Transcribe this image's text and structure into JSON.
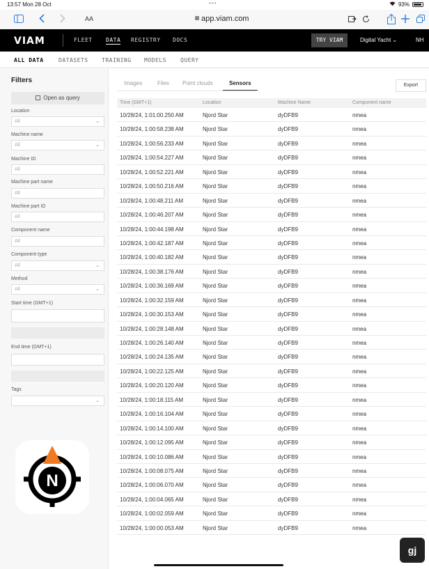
{
  "status_bar": {
    "time": "13:57  Mon 28 Oct",
    "dots": "•••",
    "battery": "93%"
  },
  "browser": {
    "aa": "AA",
    "url": "app.viam.com"
  },
  "topnav": {
    "logo": "VIAM",
    "links": [
      "FLEET",
      "DATA",
      "REGISTRY",
      "DOCS"
    ],
    "try_label": "TRY VIAM",
    "org": "Digital Yacht",
    "user": "NH"
  },
  "subnav": [
    "ALL DATA",
    "DATASETS",
    "TRAINING",
    "MODELS",
    "QUERY"
  ],
  "filters": {
    "title": "Filters",
    "open_query": "Open as query",
    "location": {
      "label": "Location",
      "value": "All"
    },
    "machine_name": {
      "label": "Machine name",
      "value": "All"
    },
    "machine_id": {
      "label": "Machine ID",
      "value": "All"
    },
    "machine_part_name": {
      "label": "Machine part name",
      "value": "All"
    },
    "machine_part_id": {
      "label": "Machine part ID",
      "value": "All"
    },
    "component_name": {
      "label": "Component name",
      "value": "All"
    },
    "component_type": {
      "label": "Component type",
      "value": "All"
    },
    "method": {
      "label": "Method",
      "value": "All"
    },
    "start_time": {
      "label": "Start time (GMT+1)"
    },
    "end_time": {
      "label": "End time (GMT+1)"
    },
    "tags": {
      "label": "Tags"
    }
  },
  "main": {
    "tabs": [
      "Images",
      "Files",
      "Point clouds",
      "Sensors"
    ],
    "active_tab": "Sensors",
    "export_label": "Export",
    "columns": [
      "Time (GMT+1)",
      "Location",
      "Machine Name",
      "Component name"
    ],
    "rows": [
      [
        "10/28/24, 1:01:00.250 AM",
        "Njord Star",
        "dyDFB9",
        "nmea"
      ],
      [
        "10/28/24, 1:00:58.238 AM",
        "Njord Star",
        "dyDFB9",
        "nmea"
      ],
      [
        "10/28/24, 1:00:56.233 AM",
        "Njord Star",
        "dyDFB9",
        "nmea"
      ],
      [
        "10/28/24, 1:00:54.227 AM",
        "Njord Star",
        "dyDFB9",
        "nmea"
      ],
      [
        "10/28/24, 1:00:52.221 AM",
        "Njord Star",
        "dyDFB9",
        "nmea"
      ],
      [
        "10/28/24, 1:00:50.216 AM",
        "Njord Star",
        "dyDFB9",
        "nmea"
      ],
      [
        "10/28/24, 1:00:48.211 AM",
        "Njord Star",
        "dyDFB9",
        "nmea"
      ],
      [
        "10/28/24, 1:00:46.207 AM",
        "Njord Star",
        "dyDFB9",
        "nmea"
      ],
      [
        "10/28/24, 1:00:44.198 AM",
        "Njord Star",
        "dyDFB9",
        "nmea"
      ],
      [
        "10/28/24, 1:00:42.187 AM",
        "Njord Star",
        "dyDFB9",
        "nmea"
      ],
      [
        "10/28/24, 1:00:40.182 AM",
        "Njord Star",
        "dyDFB9",
        "nmea"
      ],
      [
        "10/28/24, 1:00:38.176 AM",
        "Njord Star",
        "dyDFB9",
        "nmea"
      ],
      [
        "10/28/24, 1:00:36.169 AM",
        "Njord Star",
        "dyDFB9",
        "nmea"
      ],
      [
        "10/28/24, 1:00:32.159 AM",
        "Njord Star",
        "dyDFB9",
        "nmea"
      ],
      [
        "10/28/24, 1:00:30.153 AM",
        "Njord Star",
        "dyDFB9",
        "nmea"
      ],
      [
        "10/28/24, 1:00:28.148 AM",
        "Njord Star",
        "dyDFB9",
        "nmea"
      ],
      [
        "10/28/24, 1:00:26.140 AM",
        "Njord Star",
        "dyDFB9",
        "nmea"
      ],
      [
        "10/28/24, 1:00:24.135 AM",
        "Njord Star",
        "dyDFB9",
        "nmea"
      ],
      [
        "10/28/24, 1:00:22.125 AM",
        "Njord Star",
        "dyDFB9",
        "nmea"
      ],
      [
        "10/28/24, 1:00:20.120 AM",
        "Njord Star",
        "dyDFB9",
        "nmea"
      ],
      [
        "10/28/24, 1:00:18.115 AM",
        "Njord Star",
        "dyDFB9",
        "nmea"
      ],
      [
        "10/28/24, 1:00:16.104 AM",
        "Njord Star",
        "dyDFB9",
        "nmea"
      ],
      [
        "10/28/24, 1:00:14.100 AM",
        "Njord Star",
        "dyDFB9",
        "nmea"
      ],
      [
        "10/28/24, 1:00:12.095 AM",
        "Njord Star",
        "dyDFB9",
        "nmea"
      ],
      [
        "10/28/24, 1:00:10.086 AM",
        "Njord Star",
        "dyDFB9",
        "nmea"
      ],
      [
        "10/28/24, 1:00:08.075 AM",
        "Njord Star",
        "dyDFB9",
        "nmea"
      ],
      [
        "10/28/24, 1:00:06.070 AM",
        "Njord Star",
        "dyDFB9",
        "nmea"
      ],
      [
        "10/28/24, 1:00:04.065 AM",
        "Njord Star",
        "dyDFB9",
        "nmea"
      ],
      [
        "10/28/24, 1:00:02.059 AM",
        "Njord Star",
        "dyDFB9",
        "nmea"
      ],
      [
        "10/28/24, 1:00:00.053 AM",
        "Njord Star",
        "dyDFB9",
        "nmea"
      ]
    ]
  },
  "app_icon_letter": "N",
  "help_fab_label": "gj",
  "colors": {
    "nav_bg": "#000000",
    "accent_orange": "#f07a22",
    "link_blue": "#2a7de1"
  }
}
